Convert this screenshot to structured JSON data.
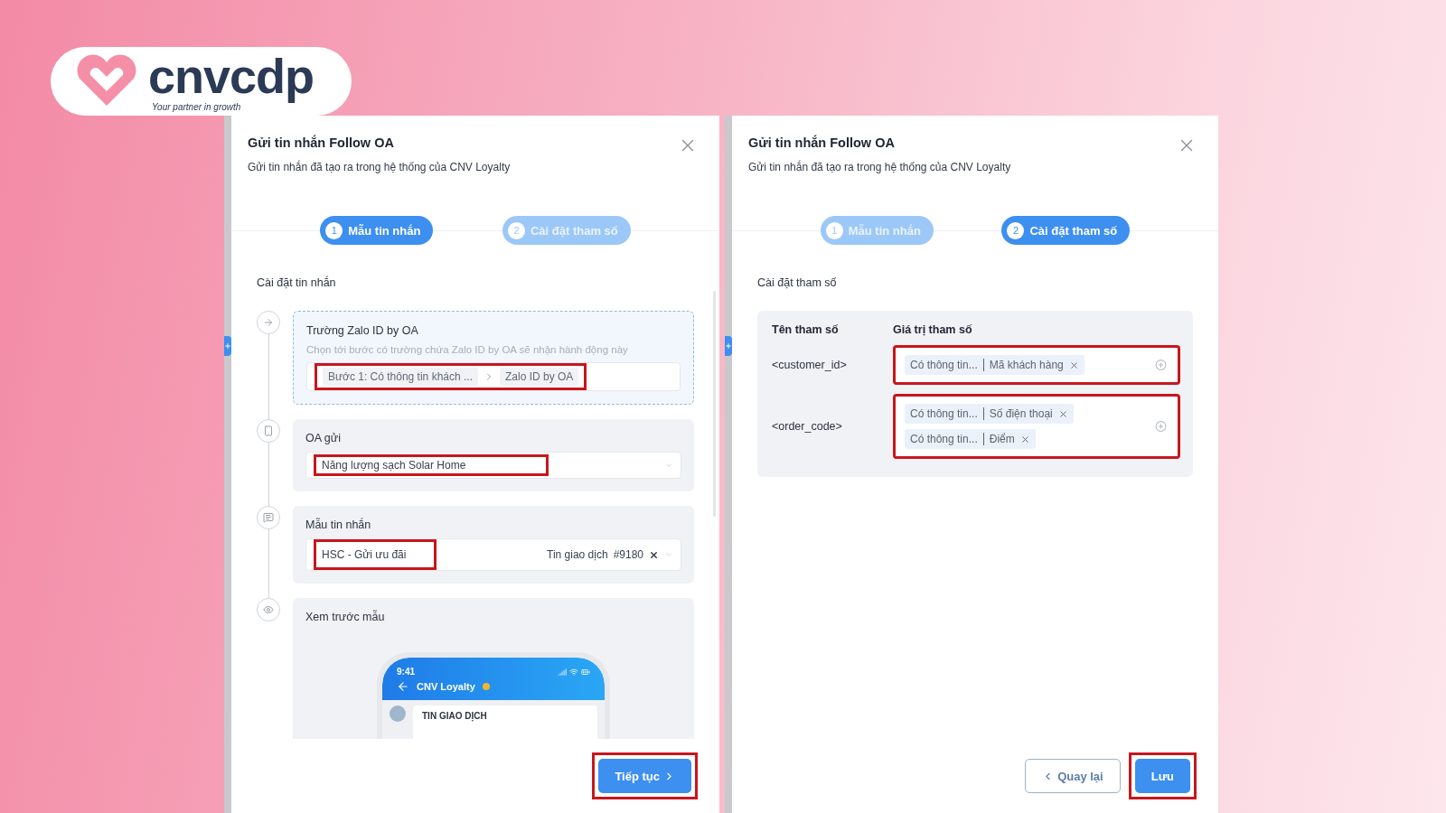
{
  "brand": {
    "name": "cnvcdp",
    "tagline": "Your partner in growth"
  },
  "panels": [
    {
      "kind": "template",
      "title": "Gửi tin nhắn Follow OA",
      "subtitle": "Gửi tin nhắn đã tạo ra trong hệ thống của CNV Loyalty",
      "steps": [
        {
          "number": "1",
          "label": "Mẫu tin nhắn",
          "selected": true
        },
        {
          "number": "2",
          "label": "Cài đặt tham số",
          "selected": false
        }
      ],
      "section_title": "Cài đặt tin nhắn",
      "items": [
        {
          "kind": "zalo-field",
          "label": "Trường Zalo ID by OA",
          "hint": "Chọn tới bước có trường chứa Zalo ID by OA sẽ nhận hành động này",
          "path": [
            "Bước 1: Có thông tin khách ...",
            "Zalo ID by OA"
          ],
          "highlighted": true
        },
        {
          "kind": "oa-select",
          "label": "OA gửi",
          "value": "Năng lượng sạch Solar Home",
          "highlighted": true
        },
        {
          "kind": "template-select",
          "label": "Mẫu tin nhắn",
          "value": "HSC - Gửi ưu đãi",
          "tag": "Tin giao dịch",
          "code": "#9180",
          "highlighted": true
        },
        {
          "kind": "preview",
          "label": "Xem trước mẫu",
          "phone": {
            "time": "9:41",
            "name": "CNV Loyalty",
            "message_title": "TIN GIAO DỊCH"
          }
        }
      ],
      "buttons": [
        {
          "label": "Tiếp tục",
          "kind": "primary",
          "highlighted": true
        }
      ]
    },
    {
      "kind": "params",
      "title": "Gửi tin nhắn Follow OA",
      "subtitle": "Gửi tin nhắn đã tạo ra trong hệ thống của CNV Loyalty",
      "steps": [
        {
          "number": "1",
          "label": "Mẫu tin nhắn",
          "selected": false
        },
        {
          "number": "2",
          "label": "Cài đặt tham số",
          "selected": true
        }
      ],
      "section_title": "Cài đặt tham số",
      "columns": [
        "Tên tham số",
        "Giá trị tham số"
      ],
      "rows": [
        {
          "name": "<customer_id>",
          "highlighted": true,
          "tags": [
            {
              "source": "Có thông tin...",
              "field": "Mã khách hàng"
            }
          ]
        },
        {
          "name": "<order_code>",
          "highlighted": true,
          "tags": [
            {
              "source": "Có thông tin...",
              "field": "Số điện thoại"
            },
            {
              "source": "Có thông tin...",
              "field": "Điểm"
            }
          ]
        }
      ],
      "buttons": [
        {
          "label": "Quay lại",
          "kind": "secondary",
          "highlighted": false
        },
        {
          "label": "Lưu",
          "kind": "primary",
          "highlighted": true
        }
      ]
    }
  ]
}
